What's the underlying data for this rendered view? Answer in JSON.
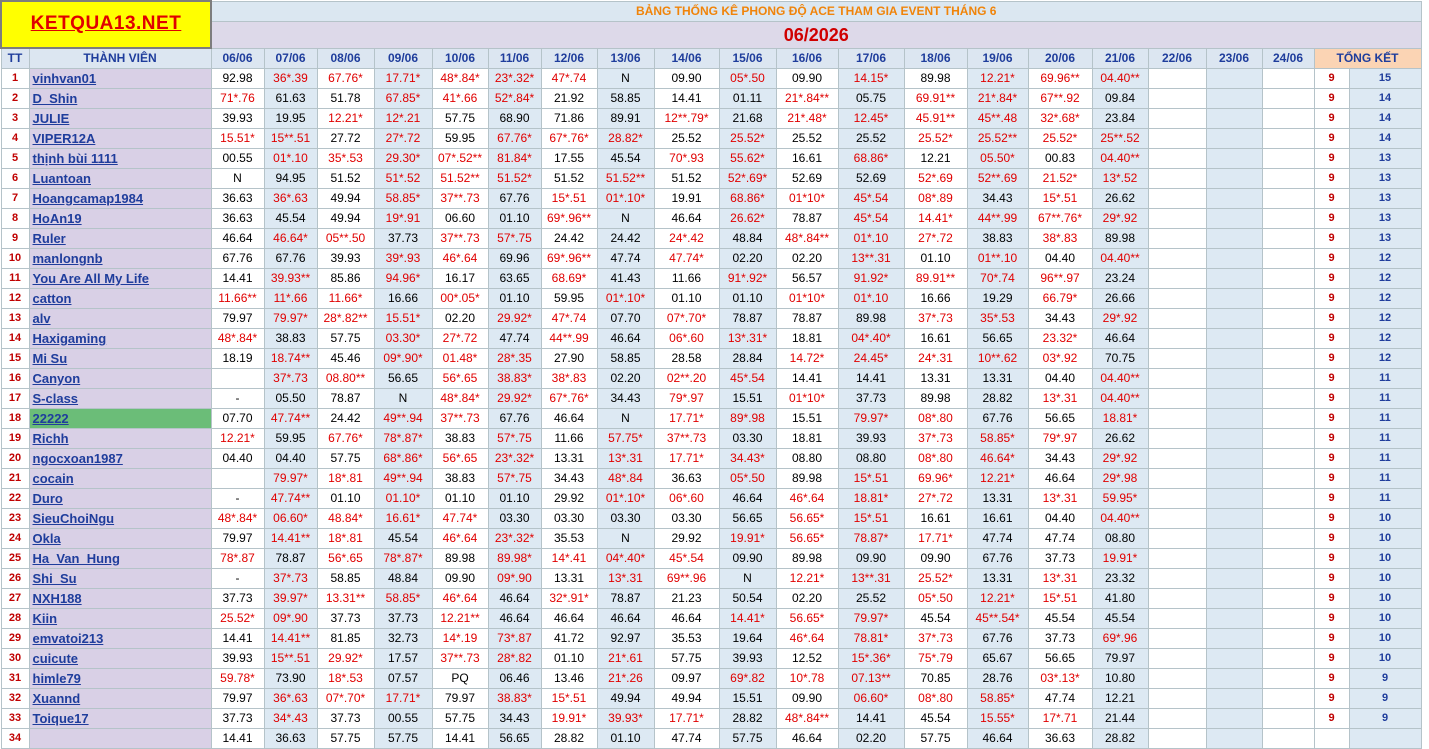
{
  "logo": "KETQUA13.NET",
  "title": "BẢNG THỐNG KÊ PHONG ĐỘ ACE THAM GIA EVENT THÁNG 6",
  "month": "06/2026",
  "headers": {
    "tt": "TT",
    "member": "THÀNH VIÊN",
    "dates": [
      "06/06",
      "07/06",
      "08/06",
      "09/06",
      "10/06",
      "11/06",
      "12/06",
      "13/06",
      "14/06",
      "15/06",
      "16/06",
      "17/06",
      "18/06",
      "19/06",
      "20/06",
      "21/06",
      "22/06",
      "23/06",
      "24/06"
    ],
    "total": "TỔNG KẾT"
  },
  "rows": [
    {
      "tt": "1",
      "name": "vinhvan01",
      "c": [
        "92.98",
        "36*.39",
        "67.76*",
        "17.71*",
        "48*.84*",
        "23*.32*",
        "47*.74",
        "N",
        "09.90",
        "05*.50",
        "09.90",
        "14.15*",
        "89.98",
        "12.21*",
        "69.96**",
        "04.40**"
      ],
      "t1": "9",
      "t2": "15"
    },
    {
      "tt": "2",
      "name": "D_Shin",
      "c": [
        "71*.76",
        "61.63",
        "51.78",
        "67.85*",
        "41*.66",
        "52*.84*",
        "21.92",
        "58.85",
        "14.41",
        "01.11",
        "21*.84**",
        "05.75",
        "69.91**",
        "21*.84*",
        "67**.92",
        "09.84"
      ],
      "t1": "9",
      "t2": "14"
    },
    {
      "tt": "3",
      "name": "JULIE",
      "c": [
        "39.93",
        "19.95",
        "12.21*",
        "12*.21",
        "57.75",
        "68.90",
        "71.86",
        "89.91",
        "12**.79*",
        "21.68",
        "21*.48*",
        "12.45*",
        "45.91**",
        "45**.48",
        "32*.68*",
        "23.84"
      ],
      "t1": "9",
      "t2": "14"
    },
    {
      "tt": "4",
      "name": "VIPER12A",
      "c": [
        "15.51*",
        "15**.51",
        "27.72",
        "27*.72",
        "59.95",
        "67.76*",
        "67*.76*",
        "28.82*",
        "25.52",
        "25.52*",
        "25.52",
        "25.52",
        "25.52*",
        "25.52**",
        "25.52*",
        "25**.52"
      ],
      "t1": "9",
      "t2": "14"
    },
    {
      "tt": "5",
      "name": "thịnh bùi 1111",
      "c": [
        "00.55",
        "01*.10",
        "35*.53",
        "29.30*",
        "07*.52**",
        "81.84*",
        "17.55",
        "45.54",
        "70*.93",
        "55.62*",
        "16.61",
        "68.86*",
        "12.21",
        "05.50*",
        "00.83",
        "04.40**"
      ],
      "t1": "9",
      "t2": "13"
    },
    {
      "tt": "6",
      "name": "Luantoan",
      "c": [
        "N",
        "94.95",
        "51.52",
        "51*.52",
        "51.52**",
        "51.52*",
        "51.52",
        "51.52**",
        "51.52",
        "52*.69*",
        "52.69",
        "52.69",
        "52*.69",
        "52**.69",
        "21.52*",
        "13*.52"
      ],
      "t1": "9",
      "t2": "13"
    },
    {
      "tt": "7",
      "name": "Hoangcamap1984",
      "c": [
        "36.63",
        "36*.63",
        "49.94",
        "58.85*",
        "37**.73",
        "67.76",
        "15*.51",
        "01*.10*",
        "19.91",
        "68.86*",
        "01*10*",
        "45*.54",
        "08*.89",
        "34.43",
        "15*.51",
        "26.62"
      ],
      "t1": "9",
      "t2": "13"
    },
    {
      "tt": "8",
      "name": "HoAn19",
      "c": [
        "36.63",
        "45.54",
        "49.94",
        "19*.91",
        "06.60",
        "01.10",
        "69*.96**",
        "N",
        "46.64",
        "26.62*",
        "78.87",
        "45*.54",
        "14.41*",
        "44**.99",
        "67**.76*",
        "29*.92"
      ],
      "t1": "9",
      "t2": "13"
    },
    {
      "tt": "9",
      "name": "Ruler",
      "c": [
        "46.64",
        "46.64*",
        "05**.50",
        "37.73",
        "37**.73",
        "57*.75",
        "24.42",
        "24.42",
        "24*.42",
        "48.84",
        "48*.84**",
        "01*.10",
        "27*.72",
        "38.83",
        "38*.83",
        "89.98"
      ],
      "t1": "9",
      "t2": "13"
    },
    {
      "tt": "10",
      "name": "manlongnb",
      "c": [
        "67.76",
        "67.76",
        "39.93",
        "39*.93",
        "46*.64",
        "69.96",
        "69*.96**",
        "47.74",
        "47.74*",
        "02.20",
        "02.20",
        "13**.31",
        "01.10",
        "01**.10",
        "04.40",
        "04.40**"
      ],
      "t1": "9",
      "t2": "12"
    },
    {
      "tt": "11",
      "name": "You Are All My Life",
      "c": [
        "14.41",
        "39.93**",
        "85.86",
        "94.96*",
        "16.17",
        "63.65",
        "68.69*",
        "41.43",
        "11.66",
        "91*.92*",
        "56.57",
        "91.92*",
        "89.91**",
        "70*.74",
        "96**.97",
        "23.24"
      ],
      "t1": "9",
      "t2": "12"
    },
    {
      "tt": "12",
      "name": "catton",
      "c": [
        "11.66**",
        "11*.66",
        "11.66*",
        "16.66",
        "00*.05*",
        "01.10",
        "59.95",
        "01*.10*",
        "01.10",
        "01.10",
        "01*10*",
        "01*.10",
        "16.66",
        "19.29",
        "66.79*",
        "26.66"
      ],
      "t1": "9",
      "t2": "12"
    },
    {
      "tt": "13",
      "name": "alv",
      "c": [
        "79.97",
        "79.97*",
        "28*.82**",
        "15.51*",
        "02.20",
        "29.92*",
        "47*.74",
        "07.70",
        "07*.70*",
        "78.87",
        "78.87",
        "89.98",
        "37*.73",
        "35*.53",
        "34.43",
        "29*.92"
      ],
      "t1": "9",
      "t2": "12"
    },
    {
      "tt": "14",
      "name": "Haxigaming",
      "c": [
        "48*.84*",
        "38.83",
        "57.75",
        "03.30*",
        "27*.72",
        "47.74",
        "44**.99",
        "46.64",
        "06*.60",
        "13*.31*",
        "18.81",
        "04*.40*",
        "16.61",
        "56.65",
        "23.32*",
        "46.64"
      ],
      "t1": "9",
      "t2": "12"
    },
    {
      "tt": "15",
      "name": "Mi Su",
      "c": [
        "18.19",
        "18.74**",
        "45.46",
        "09*.90*",
        "01.48*",
        "28*.35",
        "27.90",
        "58.85",
        "28.58",
        "28.84",
        "14.72*",
        "24.45*",
        "24*.31",
        "10**.62",
        "03*.92",
        "70.75"
      ],
      "t1": "9",
      "t2": "12"
    },
    {
      "tt": "16",
      "name": "Canyon",
      "c": [
        "",
        "37*.73",
        "08.80**",
        "56.65",
        "56*.65",
        "38.83*",
        "38*.83",
        "02.20",
        "02**.20",
        "45*.54",
        "14.41",
        "14.41",
        "13.31",
        "13.31",
        "04.40",
        "04.40**"
      ],
      "t1": "9",
      "t2": "11"
    },
    {
      "tt": "17",
      "name": "S-class",
      "c": [
        "-",
        "05.50",
        "78.87",
        "N",
        "48*.84*",
        "29.92*",
        "67*.76*",
        "34.43",
        "79*.97",
        "15.51",
        "01*10*",
        "37.73",
        "89.98",
        "28.82",
        "13*.31",
        "04.40**"
      ],
      "t1": "9",
      "t2": "11"
    },
    {
      "tt": "18",
      "name": "22222",
      "c": [
        "07.70",
        "47.74**",
        "24.42",
        "49**.94",
        "37**.73",
        "67.76",
        "46.64",
        "N",
        "17.71*",
        "89*.98",
        "15.51",
        "79.97*",
        "08*.80",
        "67.76",
        "56.65",
        "18.81*"
      ],
      "t1": "9",
      "t2": "11"
    },
    {
      "tt": "19",
      "name": "Richh",
      "c": [
        "12.21*",
        "59.95",
        "67.76*",
        "78*.87*",
        "38.83",
        "57*.75",
        "11.66",
        "57.75*",
        "37**.73",
        "03.30",
        "18.81",
        "39.93",
        "37*.73",
        "58.85*",
        "79*.97",
        "26.62"
      ],
      "t1": "9",
      "t2": "11"
    },
    {
      "tt": "20",
      "name": "ngocxoan1987",
      "c": [
        "04.40",
        "04.40",
        "57.75",
        "68*.86*",
        "56*.65",
        "23*.32*",
        "13.31",
        "13*.31",
        "17.71*",
        "34.43*",
        "08.80",
        "08.80",
        "08*.80",
        "46.64*",
        "34.43",
        "29*.92"
      ],
      "t1": "9",
      "t2": "11"
    },
    {
      "tt": "21",
      "name": "cocain",
      "c": [
        "",
        "79.97*",
        "18*.81",
        "49**.94",
        "38.83",
        "57*.75",
        "34.43",
        "48*.84",
        "36.63",
        "05*.50",
        "89.98",
        "15*.51",
        "69.96*",
        "12.21*",
        "46.64",
        "29*.98"
      ],
      "t1": "9",
      "t2": "11"
    },
    {
      "tt": "22",
      "name": "Duro",
      "c": [
        "-",
        "47.74**",
        "01.10",
        "01.10*",
        "01.10",
        "01.10",
        "29.92",
        "01*.10*",
        "06*.60",
        "46.64",
        "46*.64",
        "18.81*",
        "27*.72",
        "13.31",
        "13*.31",
        "59.95*"
      ],
      "t1": "9",
      "t2": "11"
    },
    {
      "tt": "23",
      "name": "SieuChoiNgu",
      "c": [
        "48*.84*",
        "06.60*",
        "48.84*",
        "16.61*",
        "47.74*",
        "03.30",
        "03.30",
        "03.30",
        "03.30",
        "56.65",
        "56.65*",
        "15*.51",
        "16.61",
        "16.61",
        "04.40",
        "04.40**"
      ],
      "t1": "9",
      "t2": "10"
    },
    {
      "tt": "24",
      "name": "Okla",
      "c": [
        "79.97",
        "14.41**",
        "18*.81",
        "45.54",
        "46*.64",
        "23*.32*",
        "35.53",
        "N",
        "29.92",
        "19.91*",
        "56.65*",
        "78.87*",
        "17.71*",
        "47.74",
        "47.74",
        "08.80"
      ],
      "t1": "9",
      "t2": "10"
    },
    {
      "tt": "25",
      "name": "Ha_Van_Hung",
      "c": [
        "78*.87",
        "78.87",
        "56*.65",
        "78*.87*",
        "89.98",
        "89.98*",
        "14*.41",
        "04*.40*",
        "45*.54",
        "09.90",
        "89.98",
        "09.90",
        "09.90",
        "67.76",
        "37.73",
        "19.91*"
      ],
      "t1": "9",
      "t2": "10"
    },
    {
      "tt": "26",
      "name": "Shi_Su",
      "c": [
        "-",
        "37*.73",
        "58.85",
        "48.84",
        "09.90",
        "09*.90",
        "13.31",
        "13*.31",
        "69**.96",
        "N",
        "12.21*",
        "13**.31",
        "25.52*",
        "13.31",
        "13*.31",
        "23.32"
      ],
      "t1": "9",
      "t2": "10"
    },
    {
      "tt": "27",
      "name": "NXH188",
      "c": [
        "37.73",
        "39.97*",
        "13.31**",
        "58.85*",
        "46*.64",
        "46.64",
        "32*.91*",
        "78.87",
        "21.23",
        "50.54",
        "02.20",
        "25.52",
        "05*.50",
        "12.21*",
        "15*.51",
        "41.80"
      ],
      "t1": "9",
      "t2": "10"
    },
    {
      "tt": "28",
      "name": "Kiin",
      "c": [
        "25.52*",
        "09*.90",
        "37.73",
        "37.73",
        "12.21**",
        "46.64",
        "46.64",
        "46.64",
        "46.64",
        "14.41*",
        "56.65*",
        "79.97*",
        "45.54",
        "45**.54*",
        "45.54",
        "45.54"
      ],
      "t1": "9",
      "t2": "10"
    },
    {
      "tt": "29",
      "name": "emvatoi213",
      "c": [
        "14.41",
        "14.41**",
        "81.85",
        "32.73",
        "14*.19",
        "73*.87",
        "41.72",
        "92.97",
        "35.53",
        "19.64",
        "46*.64",
        "78.81*",
        "37*.73",
        "67.76",
        "37.73",
        "69*.96"
      ],
      "t1": "9",
      "t2": "10"
    },
    {
      "tt": "30",
      "name": "cuicute",
      "c": [
        "39.93",
        "15**.51",
        "29.92*",
        "17.57",
        "37**.73",
        "28*.82",
        "01.10",
        "21*.61",
        "57.75",
        "39.93",
        "12.52",
        "15*.36*",
        "75*.79",
        "65.67",
        "56.65",
        "79.97"
      ],
      "t1": "9",
      "t2": "10"
    },
    {
      "tt": "31",
      "name": "himle79",
      "c": [
        "59.78*",
        "73.90",
        "18*.53",
        "07.57",
        "PQ",
        "06.46",
        "13.46",
        "21*.26",
        "09.97",
        "69*.82",
        "10*.78",
        "07.13**",
        "70.85",
        "28.76",
        "03*.13*",
        "10.80"
      ],
      "t1": "9",
      "t2": "9"
    },
    {
      "tt": "32",
      "name": "Xuannd",
      "c": [
        "79.97",
        "36*.63",
        "07*.70*",
        "17.71*",
        "79.97",
        "38.83*",
        "15*.51",
        "49.94",
        "49.94",
        "15.51",
        "09.90",
        "06.60*",
        "08*.80",
        "58.85*",
        "47.74",
        "12.21"
      ],
      "t1": "9",
      "t2": "9"
    },
    {
      "tt": "33",
      "name": "Toique17",
      "c": [
        "37.73",
        "34*.43",
        "37.73",
        "00.55",
        "57.75",
        "34.43",
        "19.91*",
        "39.93*",
        "17.71*",
        "28.82",
        "48*.84**",
        "14.41",
        "45.54",
        "15.55*",
        "17*.71",
        "21.44"
      ],
      "t1": "9",
      "t2": "9"
    },
    {
      "tt": "34",
      "name": "",
      "c": [
        "14.41",
        "36.63",
        "57.75",
        "57.75",
        "14.41",
        "56.65",
        "28.82",
        "01.10",
        "47.74",
        "57.75",
        "46.64",
        "02.20",
        "57.75",
        "46.64",
        "36.63",
        "28.82"
      ],
      "t1": "",
      "t2": ""
    }
  ]
}
